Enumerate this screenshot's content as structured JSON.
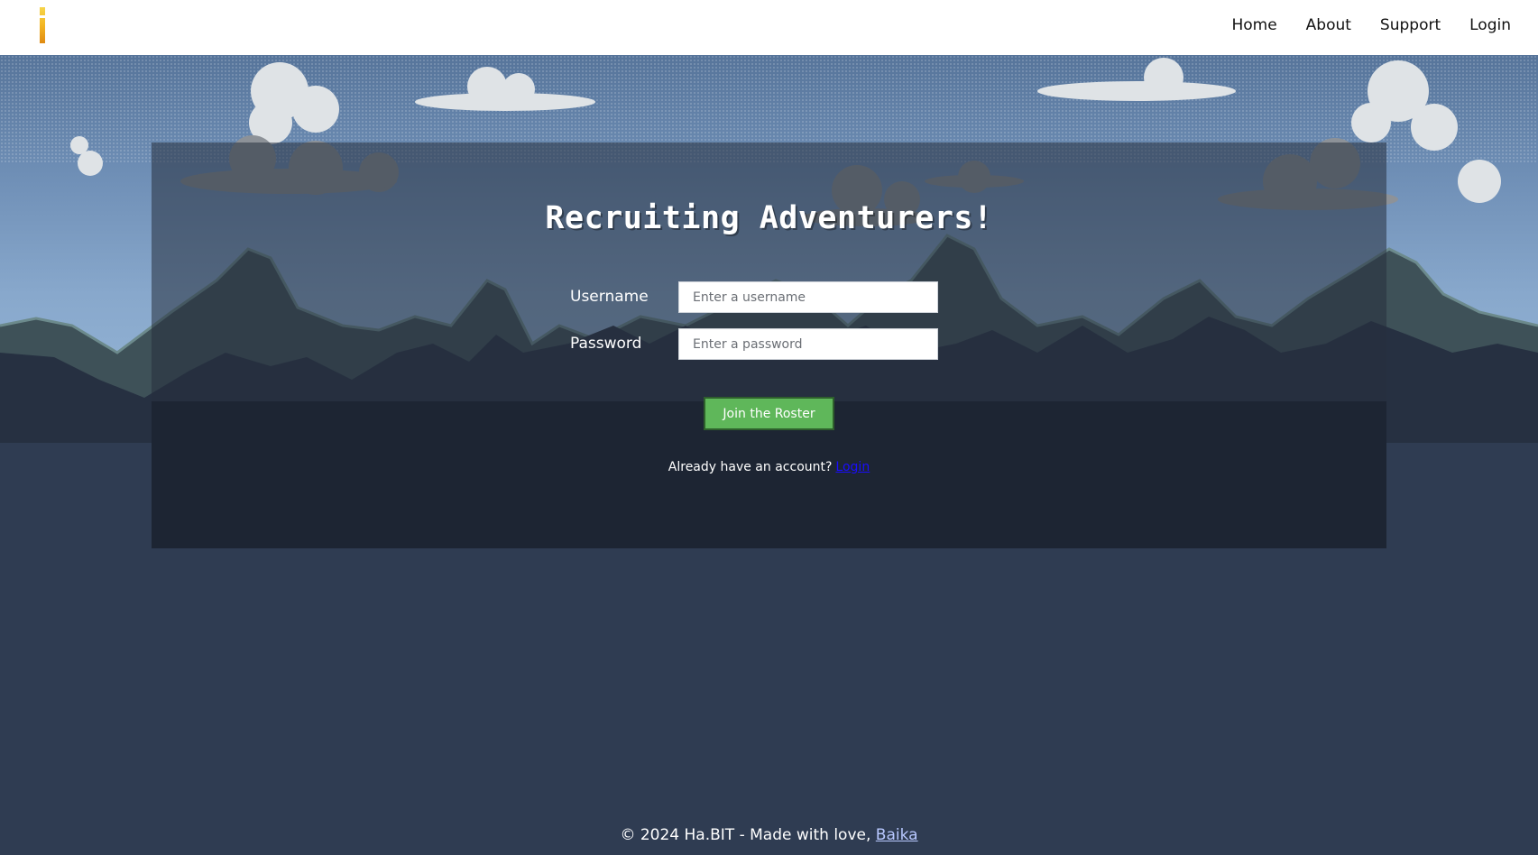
{
  "nav": {
    "logo_icon": "pixel-torch-icon",
    "links": [
      {
        "label": "Home"
      },
      {
        "label": "About"
      },
      {
        "label": "Support"
      },
      {
        "label": "Login"
      }
    ]
  },
  "form": {
    "title": "Recruiting Adventurers!",
    "username_label": "Username",
    "username_placeholder": "Enter a username",
    "username_value": "",
    "password_label": "Password",
    "password_placeholder": "Enter a password",
    "password_value": "",
    "submit_label": "Join the Roster",
    "already_text": "Already have an account?",
    "login_link": "Login"
  },
  "footer": {
    "text": "© 2024 Ha.BIT - Made with love,",
    "author_link": "Baika"
  },
  "colors": {
    "submit_bg": "#5fb75a",
    "panel_dark": "#1d2533",
    "link_blue": "#1a0dff"
  }
}
